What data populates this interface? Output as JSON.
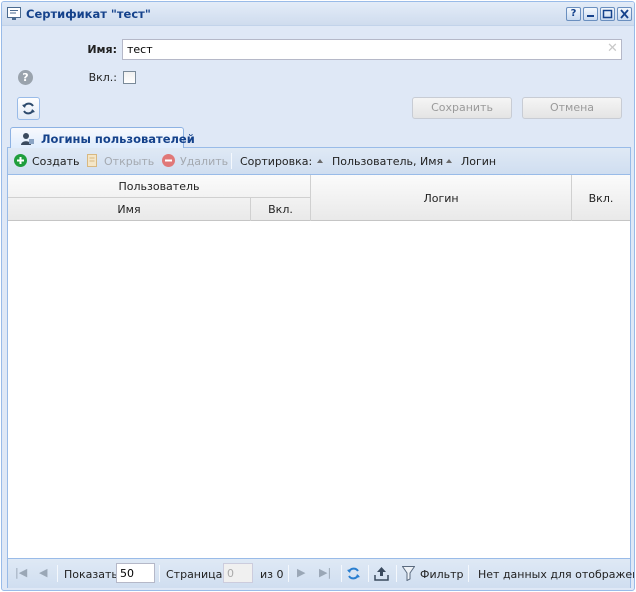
{
  "window": {
    "title": "Сертификат \"тест\"",
    "tools": {
      "help": "?",
      "minimize": "‒",
      "maximize": "□",
      "close": "✕"
    }
  },
  "form": {
    "name_label": "Имя:",
    "name_value": "тест",
    "enabled_label": "Вкл.:",
    "enabled_checked": false,
    "save_label": "Сохранить",
    "cancel_label": "Отмена"
  },
  "tabs": [
    {
      "label": "Логины пользователей",
      "icon": "user-icon",
      "active": true
    }
  ],
  "toolbar": {
    "create_label": "Создать",
    "open_label": "Открыть",
    "delete_label": "Удалить",
    "sort_label": "Сортировка:",
    "sort_user_label": "Пользователь, Имя",
    "sort_login_label": "Логин"
  },
  "grid": {
    "group_header": "Пользователь",
    "columns": {
      "user_name": "Имя",
      "user_enabled": "Вкл.",
      "login": "Логин",
      "enabled": "Вкл."
    },
    "rows": []
  },
  "pager": {
    "show_label": "Показать",
    "page_size": "50",
    "page_label": "Страница",
    "page_value": "0",
    "of_label": "из 0",
    "filter_label": "Фильтр",
    "status": "Нет данных для отображения"
  },
  "colors": {
    "header_text": "#15428b",
    "border": "#99bbe8",
    "panel_bg": "#dfe8f6",
    "create_green": "#1f9e3c",
    "delete_red": "#e07878"
  }
}
